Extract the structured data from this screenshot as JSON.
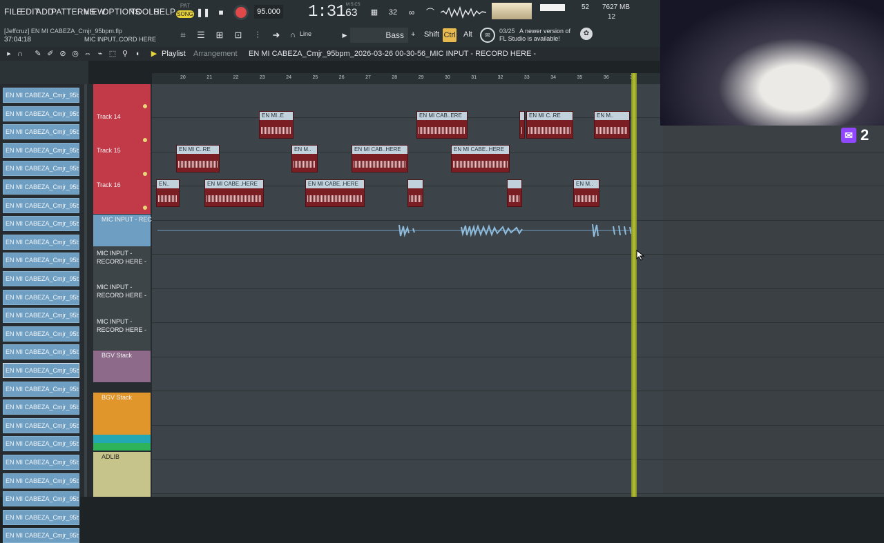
{
  "menu": {
    "items": [
      "FILE",
      "EDIT",
      "ADD",
      "PATTERNS",
      "VIEW",
      "OPTIONS",
      "TOOLS",
      "HELP"
    ]
  },
  "transport": {
    "pat_label": "PAT",
    "song_label": "SONG",
    "tempo": "95.000",
    "time": "1:31",
    "time_sub": "63",
    "time_unit": "M:S:CS"
  },
  "monitor": {
    "cpu": "52",
    "mem": "7627 MB",
    "mem_sub": "12"
  },
  "project": {
    "name": "[Jeffcruz] EN MI CABEZA_Cmjr_95bpm.flp",
    "time": "37:04:18",
    "hint": "MIC INPUT..CORD HERE"
  },
  "toolbar": {
    "snap": "Line",
    "preset": "Bass",
    "plus": "+",
    "shift": "Shift",
    "ctrl": "Ctrl",
    "alt": "Alt",
    "news_date": "03/25",
    "news_line1": "A newer version of",
    "news_line2": "FL Studio is available!"
  },
  "playlist": {
    "title": "Playlist",
    "subtitle": "Arrangement",
    "file": "EN MI CABEZA_Cmjr_95bpm_2026-03-26 00-30-56_MIC INPUT - RECORD HERE -"
  },
  "browser": {
    "items": [
      "EN MI CABEZA_Cmjr_95bp",
      "EN MI CABEZA_Cmjr_95bp",
      "EN MI CABEZA_Cmjr_95bp",
      "EN MI CABEZA_Cmjr_95bp",
      "EN MI CABEZA_Cmjr_95bp",
      "EN MI CABEZA_Cmjr_95bp",
      "EN MI CABEZA_Cmjr_95bp",
      "EN MI CABEZA_Cmjr_95bp",
      "EN MI CABEZA_Cmjr_95bp",
      "EN MI CABEZA_Cmjr_95bp",
      "EN MI CABEZA_Cmjr_95bp",
      "EN MI CABEZA_Cmjr_95bp",
      "EN MI CABEZA_Cmjr_95bp",
      "EN MI CABEZA_Cmjr_95bp",
      "EN MI CABEZA_Cmjr_95bp",
      "EN MI CABEZA_Cmjr_95bp",
      "EN MI CABEZA_Cmjr_95bp",
      "EN MI CABEZA_Cmjr_95bp",
      "EN MI CABEZA_Cmjr_95bp",
      "EN MI CABEZA_Cmjr_95bp",
      "EN MI CABEZA_Cmjr_95bp",
      "EN MI CABEZA_Cmjr_95bp",
      "EN MI CABEZA_Cmjr_95bp",
      "EN MI CABEZA_Cmjr_95bp",
      "EN MI CABEZA_Cmjr_95bp"
    ]
  },
  "tracks": {
    "t14": "Track 14",
    "t15": "Track 15",
    "t16": "Track 16",
    "mic": "MIC INPUT - REC...",
    "mic_a": "MIC INPUT -",
    "mic_b": "RECORD HERE -",
    "bgv1": "BGV Stack",
    "bgv2": "BGV Stack",
    "adlib": "ADLIB"
  },
  "ruler": {
    "bars": [
      "20",
      "21",
      "22",
      "23",
      "24",
      "25",
      "26",
      "27",
      "28",
      "29",
      "30",
      "31",
      "32",
      "33",
      "34",
      "35",
      "36",
      "37"
    ]
  },
  "clips": {
    "c1": "EN MI..E",
    "c2": "EN MI CAB..ERE",
    "c3": "",
    "c4": "EN MI C..RE",
    "c5": "EN M..",
    "c6": "EN MI C..RE",
    "c7": "EN M..",
    "c8": "EN MI CAB..HERE",
    "c9": "EN MI CABE..HERE",
    "c10": "EN..",
    "c11": "EN MI CABE..HERE",
    "c12": "EN MI CABE..HERE",
    "c13": "",
    "c14": "",
    "c15": "EN M.."
  },
  "stream": {
    "viewers": "2"
  },
  "colors": {
    "clip_red": "#7a1e24",
    "track_red": "#c23a48",
    "mic_blue": "#6e9ec2",
    "bgv_purple": "#8e6a8a",
    "bgv_orange": "#e0962a",
    "adlib_green": "#c6c48a",
    "playhead": "#c5cc32",
    "ctrl_active": "#e8b94e",
    "record": "#e0484a"
  }
}
